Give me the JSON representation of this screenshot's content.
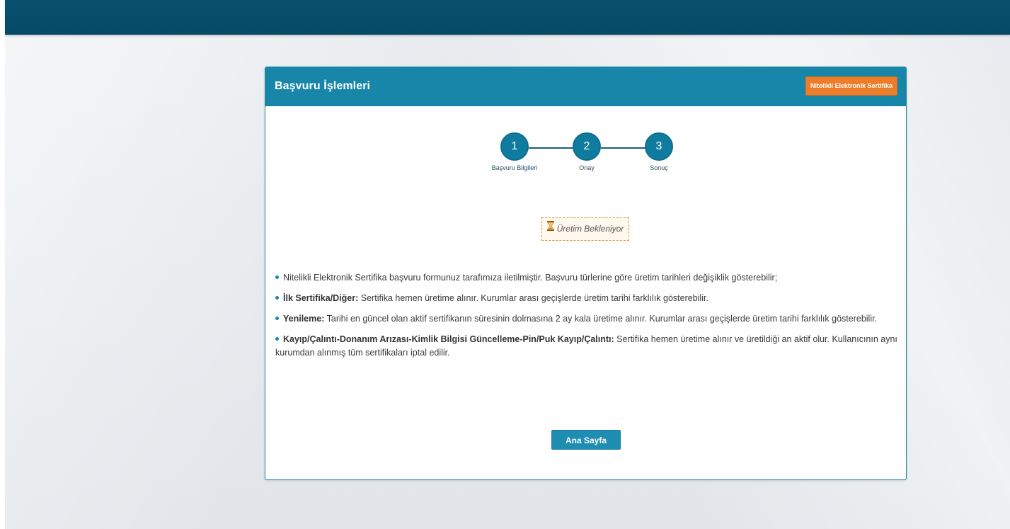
{
  "panel": {
    "title": "Başvuru İşlemleri",
    "badge_label": "Nitelikli Elektronik Sertifika",
    "accent_color": "#1786a8",
    "badge_color": "#ee7d2b"
  },
  "steps": [
    {
      "number": "1",
      "label": "Başvuru Bilgileri"
    },
    {
      "number": "2",
      "label": "Onay"
    },
    {
      "number": "3",
      "label": "Sonuç"
    }
  ],
  "status": {
    "icon": "hourglass-icon",
    "text": "Üretim Bekleniyor"
  },
  "info": {
    "item1": {
      "text": "Nitelikli Elektronik Sertifika başvuru formunuz tarafımıza iletilmiştir. Başvuru türlerine göre üretim tarihleri değişiklik gösterebilir;"
    },
    "item2": {
      "bold": "İlk Sertifika/Diğer:",
      "text": " Sertifika hemen üretime alınır. Kurumlar arası geçişlerde üretim tarihi farklılık gösterebilir."
    },
    "item3": {
      "bold": "Yenileme:",
      "text": " Tarihi en güncel olan aktif sertifikanın süresinin dolmasına 2 ay kala üretime alınır. Kurumlar arası geçişlerde üretim tarihi farklılık gösterebilir."
    },
    "item4": {
      "bold": "Kayıp/Çalıntı-Donanım Arızası-Kimlik Bilgisi Güncelleme-Pin/Puk Kayıp/Çalıntı:",
      "text": " Sertifika hemen üretime alınır ve üretildiği an aktif olur. Kullanıcının aynı kurumdan alınmış tüm sertifikaları iptal edilir."
    }
  },
  "home_button_label": "Ana Sayfa"
}
